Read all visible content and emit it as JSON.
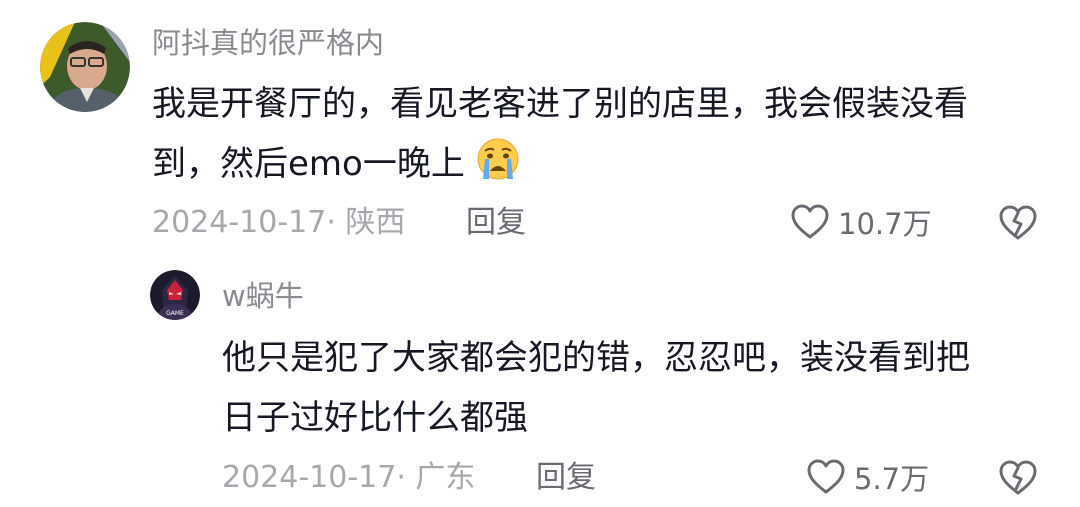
{
  "comments": [
    {
      "username": "阿抖真的很严格内",
      "text_line1": "我是开餐厅的，看见老客进了别的店里，我会假装没看",
      "text_line2": "到，然后emo一晚上",
      "emoji": "crying-face",
      "date_region": "2024-10-17· 陕西",
      "reply_label": "回复",
      "likes": "10.7万"
    }
  ],
  "replies": [
    {
      "username": "w蜗牛",
      "avatar_badge": "GAME",
      "text_line1": "他只是犯了大家都会犯的错，忍忍吧，装没看到把",
      "text_line2": "日子过好比什么都强",
      "date_region": "2024-10-17· 广东",
      "reply_label": "回复",
      "likes": "5.7万"
    }
  ],
  "colors": {
    "text": "#161823",
    "username": "#8a8b91",
    "meta": "#a7a8ad",
    "action": "#6a6b72"
  },
  "icons": [
    "heart-outline-icon",
    "broken-heart-icon",
    "crying-face-emoji"
  ]
}
